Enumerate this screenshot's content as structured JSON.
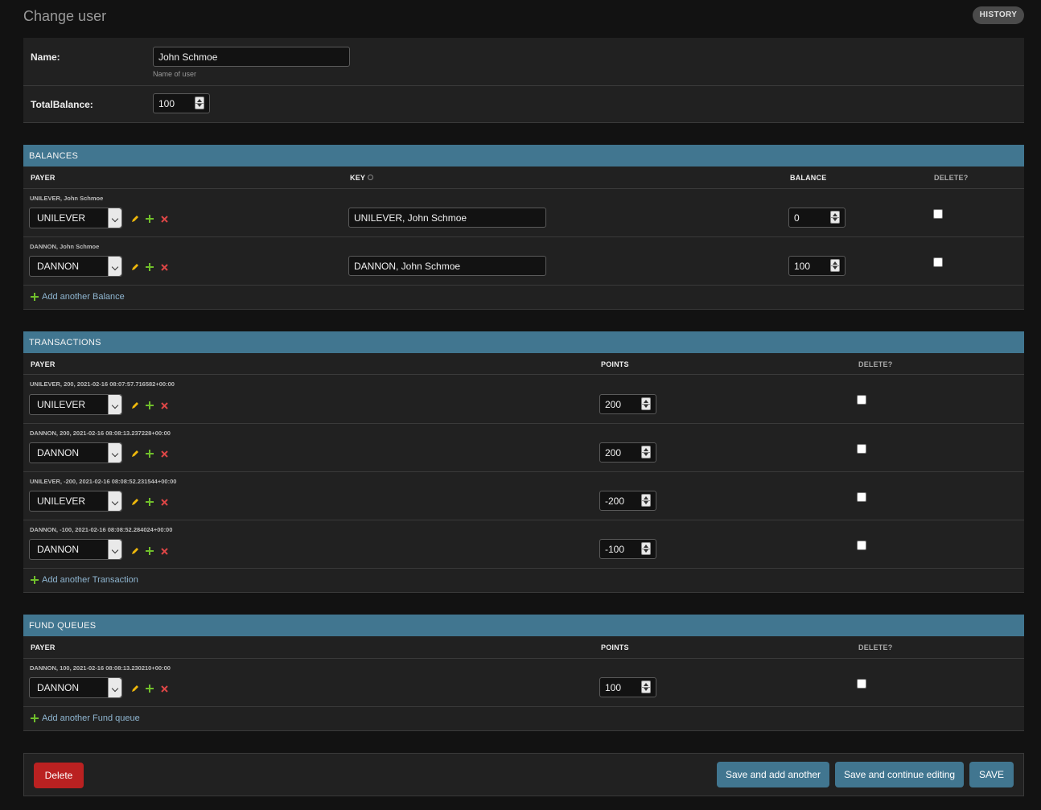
{
  "header": {
    "title": "Change user",
    "history_label": "HISTORY"
  },
  "main": {
    "name_label": "Name:",
    "name_value": "John Schmoe",
    "name_help": "Name of user",
    "total_label": "TotalBalance:",
    "total_value": "100"
  },
  "balances": {
    "title": "BALANCES",
    "col_payer": "PAYER",
    "col_key": "KEY",
    "col_balance": "BALANCE",
    "col_delete": "DELETE?",
    "rows": [
      {
        "caption": "UNILEVER, John Schmoe",
        "payer": "UNILEVER",
        "key": "UNILEVER, John Schmoe",
        "balance": "0"
      },
      {
        "caption": "DANNON, John Schmoe",
        "payer": "DANNON",
        "key": "DANNON, John Schmoe",
        "balance": "100"
      }
    ],
    "add_label": "Add another Balance"
  },
  "transactions": {
    "title": "TRANSACTIONS",
    "col_payer": "PAYER",
    "col_points": "POINTS",
    "col_delete": "DELETE?",
    "rows": [
      {
        "caption": "UNILEVER, 200, 2021-02-16 08:07:57.716582+00:00",
        "payer": "UNILEVER",
        "points": "200"
      },
      {
        "caption": "DANNON, 200, 2021-02-16 08:08:13.237228+00:00",
        "payer": "DANNON",
        "points": "200"
      },
      {
        "caption": "UNILEVER, -200, 2021-02-16 08:08:52.231544+00:00",
        "payer": "UNILEVER",
        "points": "-200"
      },
      {
        "caption": "DANNON, -100, 2021-02-16 08:08:52.284024+00:00",
        "payer": "DANNON",
        "points": "-100"
      }
    ],
    "add_label": "Add another Transaction"
  },
  "fund_queues": {
    "title": "FUND QUEUES",
    "col_payer": "PAYER",
    "col_points": "POINTS",
    "col_delete": "DELETE?",
    "rows": [
      {
        "caption": "DANNON, 100, 2021-02-16 08:08:13.230210+00:00",
        "payer": "DANNON",
        "points": "100"
      }
    ],
    "add_label": "Add another Fund queue"
  },
  "submit": {
    "delete_label": "Delete",
    "save_add_label": "Save and add another",
    "save_continue_label": "Save and continue editing",
    "save_label": "SAVE"
  },
  "colors": {
    "background": "#121212",
    "panel": "#212121",
    "module_header": "#417690",
    "delete": "#ba2121",
    "link": "#8fb6d1",
    "change_icon": "#efb80b",
    "add_icon": "#70bf2b",
    "remove_icon": "#dd4646"
  }
}
